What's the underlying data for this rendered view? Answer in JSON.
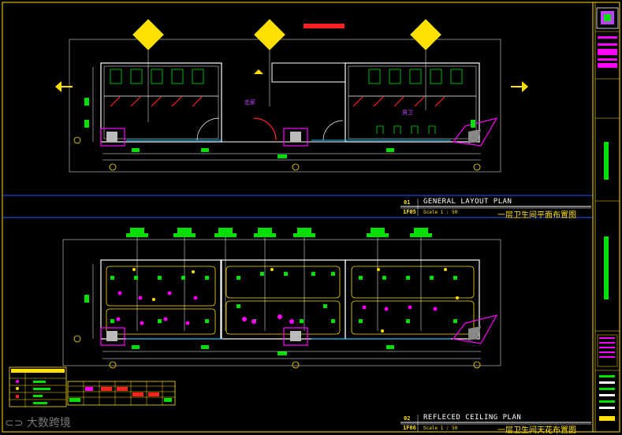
{
  "drawing": {
    "plan1": {
      "number": "01",
      "sheet_ref": "1F05",
      "title_en": "GENERAL LAYOUT PLAN",
      "scale": "Scale 1 : 50",
      "title_cn": "一层卫生间平面布置图"
    },
    "plan2": {
      "number": "02",
      "sheet_ref": "1F06",
      "title_en": "REFLECED CEILING PLAN",
      "scale": "Scale 1 : 50",
      "title_cn": "一层卫生间天花布置图"
    },
    "room_labels": [
      "走廊",
      "男卫"
    ],
    "watermark": "大数跨境"
  },
  "colors": {
    "background": "#000000",
    "wall": "#ffffff",
    "green": "#00e000",
    "magenta": "#ff00ff",
    "yellow": "#ffe000",
    "cyan": "#00c0ff",
    "red": "#ff2020",
    "blue": "#2a2aff"
  }
}
